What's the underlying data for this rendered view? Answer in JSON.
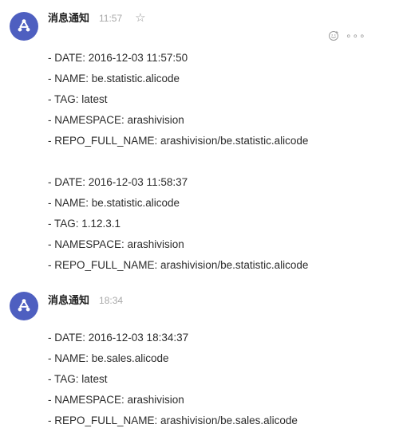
{
  "messages": [
    {
      "sender": "消息通知",
      "time": "11:57",
      "blocks": [
        [
          "- DATE: 2016-12-03 11:57:50",
          "- NAME: be.statistic.alicode",
          "- TAG: latest",
          "- NAMESPACE: arashivision",
          "- REPO_FULL_NAME: arashivision/be.statistic.alicode"
        ],
        [
          "- DATE: 2016-12-03 11:58:37",
          "- NAME: be.statistic.alicode",
          "- TAG: 1.12.3.1",
          "- NAMESPACE: arashivision",
          "- REPO_FULL_NAME: arashivision/be.statistic.alicode"
        ]
      ]
    },
    {
      "sender": "消息通知",
      "time": "18:34",
      "blocks": [
        [
          "- DATE: 2016-12-03 18:34:37",
          "- NAME: be.sales.alicode",
          "- TAG: latest",
          "- NAMESPACE: arashivision",
          "- REPO_FULL_NAME: arashivision/be.sales.alicode"
        ]
      ]
    }
  ],
  "icons": {
    "avatar": "webhook-icon",
    "favorite": "star-outline-icon",
    "reaction": "emoji-smile-icon",
    "more": "more-dots-icon"
  },
  "colors": {
    "avatar_bg": "#4e5fc0",
    "text": "#2b2b2b",
    "timestamp": "#a8a8a8"
  }
}
